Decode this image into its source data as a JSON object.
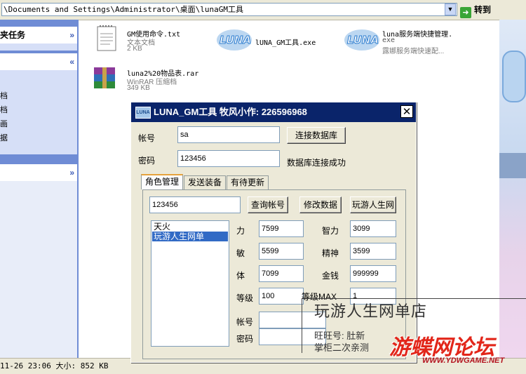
{
  "address_bar": {
    "path": "\\Documents and Settings\\Administrator\\桌面\\lunaGM工具",
    "go_label": "转到",
    "go_icon": "arrow-right-icon"
  },
  "task_pane": {
    "section1_title": "夹任务",
    "section2_items": [
      "档",
      "档",
      "画",
      "据"
    ]
  },
  "files": [
    {
      "name": "GM使用命令.txt",
      "type": "文本文档",
      "size": "2 KB",
      "icon": "text-document-icon"
    },
    {
      "name": "lUNA_GM工具.exe",
      "type": "",
      "size": "",
      "icon": "luna-app-icon"
    },
    {
      "name": "luna服务端快捷管理.",
      "type": "exe",
      "size": "露娜服务端快速配...",
      "icon": "luna-app-icon"
    },
    {
      "name": "luna2%20物品表.rar",
      "type": "WinRAR 压缩档",
      "size": "349 KB",
      "icon": "winrar-archive-icon"
    }
  ],
  "status_bar": {
    "text": "11-26 23:06 大小: 852 KB"
  },
  "dialog": {
    "title": "LUNA_GM工具  牧风小作: 226596968",
    "close_label": "✕",
    "account_label": "帐号",
    "account_value": "sa",
    "password_label": "密码",
    "password_value": "123456",
    "connect_button": "连接数据库",
    "connect_status": "数据库连接成功",
    "tabs": [
      "角色管理",
      "发送装备",
      "有待更新"
    ],
    "search_value": "123456",
    "query_button": "查询帐号",
    "modify_button": "修改数据",
    "extra_button": "玩游人生网",
    "characters": [
      "天火",
      "玩游人生网单"
    ],
    "stats": {
      "str_label": "力",
      "str_value": "7599",
      "int_label": "智力",
      "int_value": "3099",
      "agi_label": "敏",
      "agi_value": "5599",
      "spi_label": "精神",
      "spi_value": "3599",
      "vit_label": "体",
      "vit_value": "7099",
      "money_label": "金钱",
      "money_value": "999999",
      "level_label": "等级",
      "level_value": "100",
      "maxlevel_label": "等级MAX",
      "maxlevel_value": "1"
    },
    "acct2_label": "帐号",
    "pwd2_label": "密码"
  },
  "watermark": {
    "shop_title": "玩游人生网单店",
    "line2": "旺旺号: 肚新",
    "line3": "掌柜二次亲测",
    "logo": "游蝶网论坛",
    "url": "WWW.YDWGAME.NET"
  }
}
